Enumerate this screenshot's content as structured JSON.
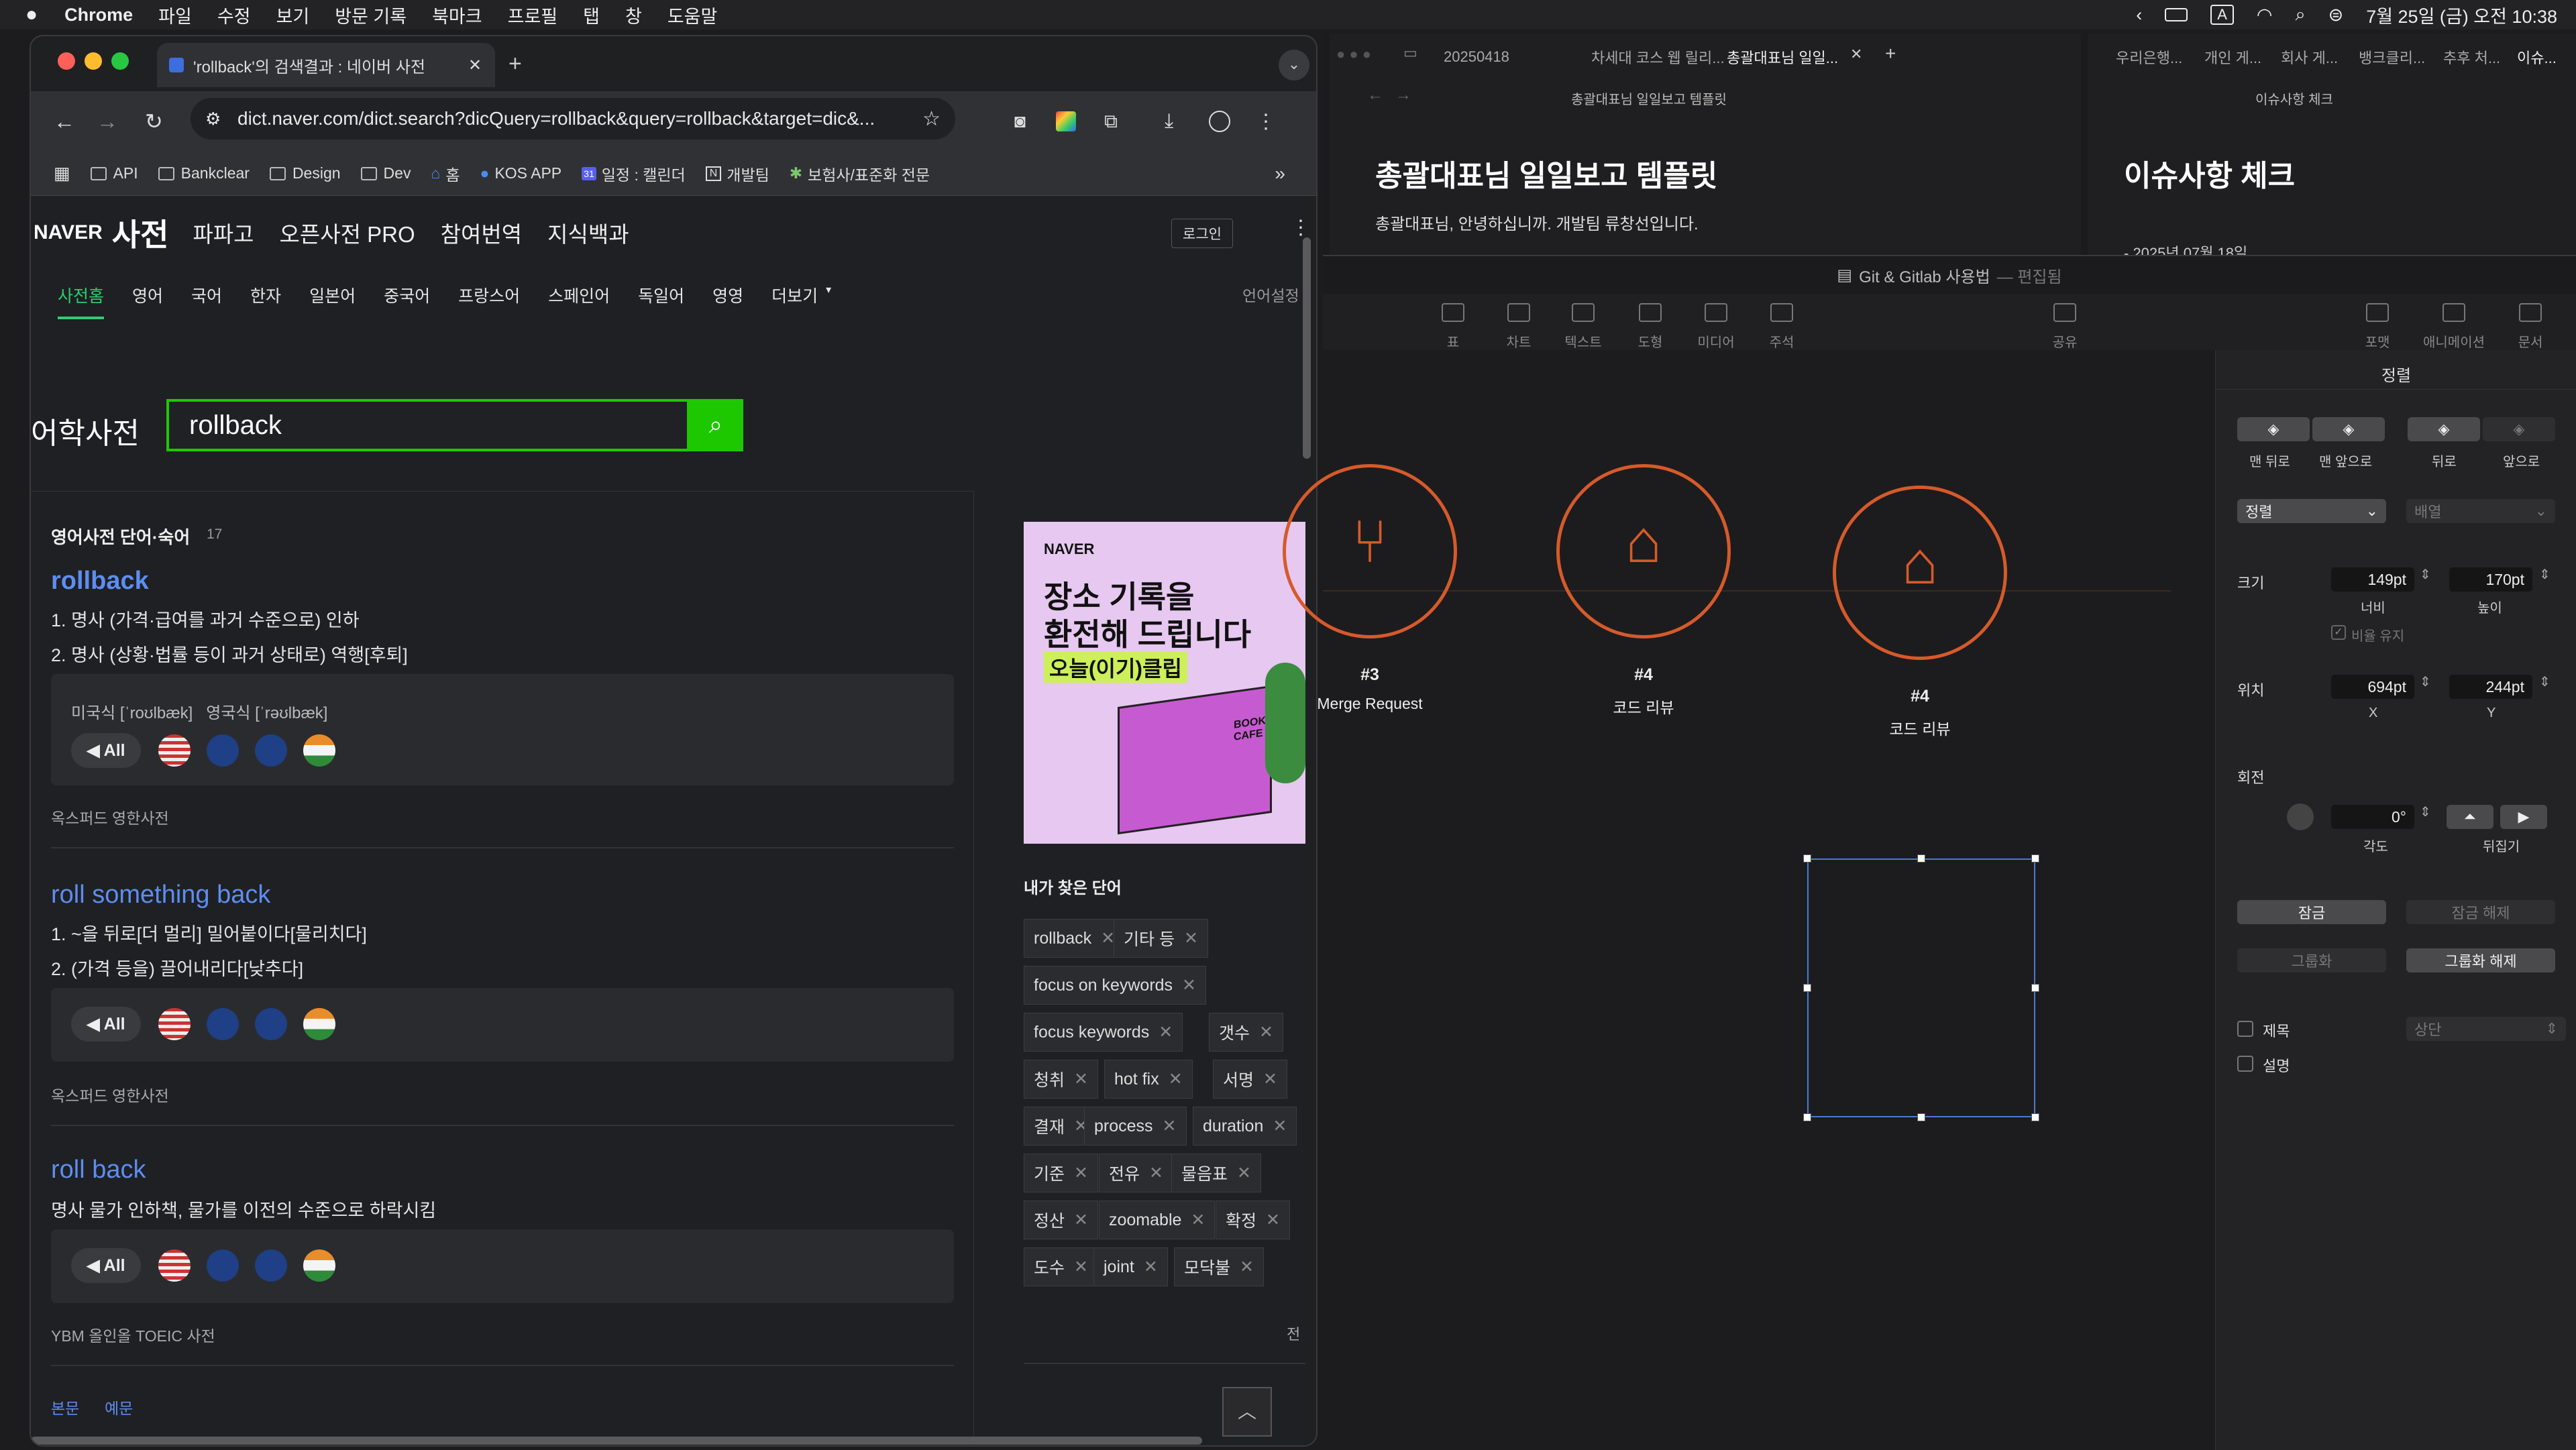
{
  "menubar": {
    "app": "Chrome",
    "items": [
      "파일",
      "수정",
      "보기",
      "방문 기록",
      "북마크",
      "프로필",
      "탭",
      "창",
      "도움말"
    ],
    "input_indicator": "A",
    "datetime": "7월 25일 (금) 오전 10:38"
  },
  "chrome": {
    "tab_title": "'rollback'의 검색결과 : 네이버 사전",
    "url": "dict.naver.com/dict.search?dicQuery=rollback&query=rollback&target=dic&...",
    "bookmarks": [
      "API",
      "Bankclear",
      "Design",
      "Dev",
      "홈",
      "KOS APP",
      "일정 : 캘린더",
      "개발팀",
      "보험사/표준화 전문"
    ],
    "bookmark_calendar_num": "31"
  },
  "naver": {
    "logo": "NAVER",
    "service": "사전",
    "nav": [
      "파파고",
      "오픈사전 PRO",
      "참여번역",
      "지식백과"
    ],
    "login": "로그인",
    "categories": [
      "사전홈",
      "영어",
      "국어",
      "한자",
      "일본어",
      "중국어",
      "프랑스어",
      "스페인어",
      "독일어",
      "영영",
      "더보기"
    ],
    "lang_setting": "언어설정",
    "search_label": "어학사전",
    "search_value": "rollback",
    "section_title": "영어사전 단어·숙어",
    "section_count": "17",
    "entries": [
      {
        "title": "rollback",
        "lines": [
          "1. 명사  (가격·급여를 과거 수준으로) 인하",
          "2. 명사  (상황·법률 등이 과거 상태로) 역행[후퇴]"
        ],
        "pron": "미국식 [ˈroʊlbæk]   영국식 [ˈrəʊlbæk]",
        "source": "옥스퍼드 영한사전"
      },
      {
        "title": "roll something back",
        "lines": [
          "1. ~을 뒤로[더 멀리] 밀어붙이다[물리치다]",
          "2. (가격 등을) 끌어내리다[낮추다]"
        ],
        "source": "옥스퍼드 영한사전"
      },
      {
        "title": "roll back",
        "lines": [
          "명사  물가 인하책, 물가를 이전의 수준으로 하락시킴"
        ],
        "source": "YBM 올인올 TOEIC 사전"
      }
    ],
    "all_label": "All",
    "footer_tabs": [
      "본문",
      "예문"
    ],
    "ad": {
      "brand": "NAVER",
      "line1": "장소 기록을",
      "line2": "환전해 드립니다",
      "line3": "오늘(이기)클립",
      "book": "BOOK CAFE"
    },
    "my_words_title": "내가 찾은 단어",
    "my_words": [
      "rollback",
      "기타 등",
      "focus on keywords",
      "focus keywords",
      "갯수",
      "청취",
      "hot fix",
      "서명",
      "결재",
      "process",
      "duration",
      "기준",
      "전유",
      "물음표",
      "정산",
      "zoomable",
      "확정",
      "도수",
      "joint",
      "모닥불"
    ],
    "more_link": "전"
  },
  "right": {
    "tabs_left": [
      "20250418",
      "차세대 코스 웹 릴리...",
      "총괄대표님 일일..."
    ],
    "tabs_right": [
      "우리은행...",
      "개인 게...",
      "회사 게...",
      "뱅크클리...",
      "추후 처...",
      "이슈..."
    ],
    "doc1_path": "총괄대표님 일일보고 템플릿",
    "doc1_title": "총괄대표님 일일보고 템플릿",
    "doc1_body": "총괄대표님, 안녕하십니까. 개발팀 류창선입니다.",
    "doc2_path": "이슈사항 체크",
    "doc2_title": "이슈사항 체크",
    "doc2_body": "- 2025년 07월 18일",
    "keynote_title": "Git & Gitlab 사용법",
    "keynote_status": "— 편집됨",
    "tools": [
      "표",
      "차트",
      "텍스트",
      "도형",
      "미디어",
      "주석",
      "공유"
    ],
    "tools_right": [
      "포맷",
      "애니메이션",
      "문서"
    ],
    "nodes": [
      {
        "num": "#3",
        "label": "Merge Request"
      },
      {
        "num": "#4",
        "label": "코드 리뷰"
      },
      {
        "num": "#4",
        "label": "코드 리뷰"
      }
    ]
  },
  "inspector": {
    "title": "정렬",
    "order_buttons": [
      "맨 뒤로",
      "맨 앞으로",
      "뒤로",
      "앞으로"
    ],
    "align_select": "정렬",
    "distribute_select": "배열",
    "size_label": "크기",
    "width": "149pt",
    "height": "170pt",
    "width_label": "너비",
    "height_label": "높이",
    "keep_ratio": "비율 유지",
    "pos_label": "위치",
    "x": "694pt",
    "y": "244pt",
    "x_label": "X",
    "y_label": "Y",
    "rotate_label": "회전",
    "angle": "0°",
    "angle_label": "각도",
    "flip_label": "뒤집기",
    "lock": "잠금",
    "unlock": "잠금 해제",
    "group": "그룹화",
    "ungroup": "그룹화 해제",
    "title_check": "제목",
    "desc_check": "설명",
    "title_pos": "상단",
    "accent": "#d65a2a"
  }
}
